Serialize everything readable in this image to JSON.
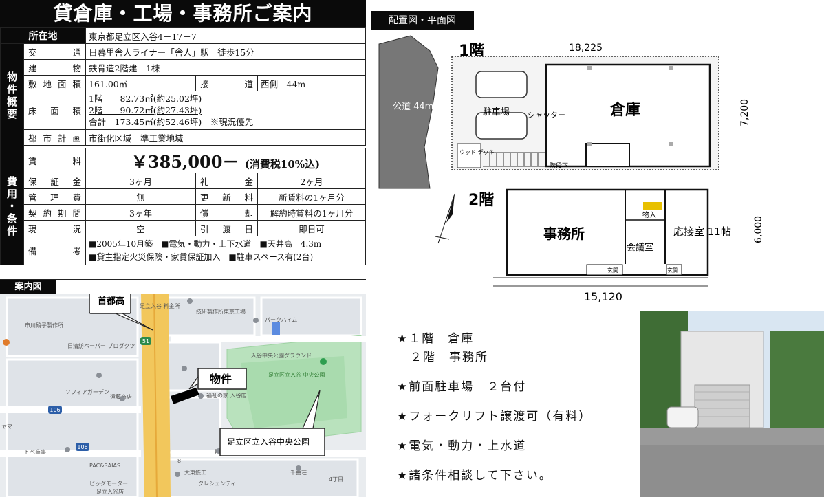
{
  "title": "貸倉庫・工場・事務所ご案内",
  "location": {
    "label": "所在地",
    "value": "東京都足立区入谷4－17－7"
  },
  "section_property": "物件概要",
  "section_cost": "費用・条件",
  "property": {
    "access": {
      "label": "交通",
      "value": "日暮里舎人ライナー「舎人」駅　徒歩15分"
    },
    "structure": {
      "label": "建物",
      "value": "鉄骨造2階建　1棟"
    },
    "land_area": {
      "label": "敷地面積",
      "value": "161.00㎡"
    },
    "road": {
      "label": "接道",
      "value": "西側　44m"
    },
    "floor_area": {
      "label": "床面積",
      "line1": "1階　　82.73㎡(約25.02坪)",
      "line2": "2階　　90.72㎡(約27.43坪)",
      "line3": "合計　173.45㎡(約52.46坪)　※現況優先"
    },
    "city_plan": {
      "label": "都市計画",
      "value": "市街化区域　準工業地域"
    }
  },
  "cost": {
    "rent": {
      "label": "賃料",
      "value": "￥385,000－",
      "tax": "(消費税10%込)"
    },
    "deposit": {
      "label": "保証金",
      "value": "3ヶ月"
    },
    "key_money": {
      "label": "礼金",
      "value": "2ヶ月"
    },
    "management": {
      "label": "管理費",
      "value": "無"
    },
    "renewal": {
      "label": "更新料",
      "value": "新賃料の1ヶ月分"
    },
    "term": {
      "label": "契約期間",
      "value": "3ヶ年"
    },
    "amortization": {
      "label": "償却",
      "value": "解約時賃料の1ヶ月分"
    },
    "status": {
      "label": "現況",
      "value": "空"
    },
    "handover": {
      "label": "引渡日",
      "value": "即日可"
    },
    "remarks": {
      "label": "備考",
      "line1": "■2005年10月築　■電気・動力・上下水道　■天井高　4.3m",
      "line2": "■貸主指定火災保険・家賃保証加入　■駐車スペース有(2台)"
    }
  },
  "map": {
    "tab": "案内図",
    "labels": {
      "expressway": "首都高",
      "property": "物件",
      "park_callout": "足立区立入谷中央公園",
      "factory": "技研製作所東京工場",
      "ichikawa": "市川硝子製作所",
      "nisshinbo": "日清紡ペーパー\nプロダクツ",
      "toll": "足立入谷\n料金所",
      "park_heim": "パークハイム",
      "park_ground": "入谷中央公園グラウンド",
      "park_name": "足立区立入谷\n中央公園",
      "sofia": "ソフィアガーデン",
      "endo": "遠藤商店",
      "fukushi": "福祉の家 入谷店",
      "route106": "106",
      "route51": "51",
      "tobe": "トベ商事",
      "pac": "PAC&SAIAS",
      "big": "ビッグモーター",
      "big2": "足立入谷店",
      "daiko": "大東鉄工",
      "crecent": "クレシェンティ",
      "saimaru": "再光",
      "senju": "千曲荘",
      "yon": "4丁目",
      "yamazaki": "ヤマ",
      "number8": "8"
    }
  },
  "plan": {
    "tab": "配置図・平面図",
    "floor1": "1階",
    "floor2": "2階",
    "dim_top": "18,225",
    "dim_right1": "7,200",
    "dim_right2": "6,000",
    "dim_bottom": "15,120",
    "public_road": "公道\n44m",
    "warehouse": "倉庫",
    "parking": "駐車場",
    "shutter": "シャッター",
    "wood_deck": "ウッド\nデッキ",
    "corridor": "階段下",
    "office": "事務所",
    "meeting": "会議室",
    "reception": "応接室\n11帖",
    "storage": "物入",
    "entrance": "玄関"
  },
  "notes": [
    "★１階　倉庫",
    "　２階　事務所",
    "★前面駐車場　２台付",
    "★フォークリフト譲渡可（有料）",
    "★電気・動力・上水道",
    "★諸条件相談して下さい。"
  ]
}
